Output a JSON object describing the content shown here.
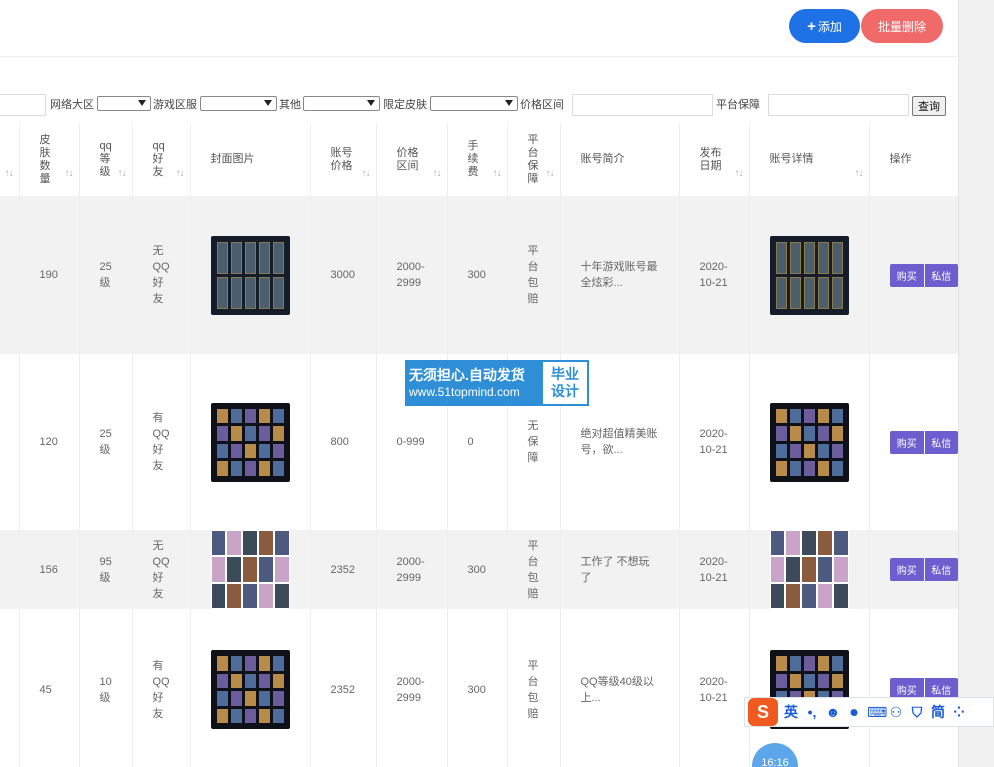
{
  "toolbar": {
    "add_label": "添加",
    "batch_delete_label": "批量删除"
  },
  "filters": {
    "network_label": "网络大区",
    "zone_label": "游戏区服",
    "other_label": "其他",
    "skin_label": "限定皮肤",
    "price_label": "价格区间",
    "guarantee_label": "平台保障",
    "query_label": "查询"
  },
  "table": {
    "headers": {
      "skin_count": "皮肤数量",
      "qq_level": "qq等级",
      "qq_friend": "qq好友",
      "cover": "封面图片",
      "price": "账号价格",
      "price_range": "价格区间",
      "fee": "手续费",
      "guarantee": "平台保障",
      "intro": "账号简介",
      "date": "发布日期",
      "detail": "账号详情",
      "ops": "操作"
    },
    "sort_icon": "↑↓",
    "rows": [
      {
        "skins": "190",
        "level": "25级",
        "friend": "无QQ好友",
        "price": "3000",
        "range": "2000-2999",
        "fee": "300",
        "guarantee": "平台包赔",
        "intro": "十年游戏账号最全炫彩...",
        "date": "2020-10-21"
      },
      {
        "skins": "120",
        "level": "25级",
        "friend": "有QQ好友",
        "price": "800",
        "range": "0-999",
        "fee": "0",
        "guarantee": "无保障",
        "intro": "绝对超值精美账号，欲...",
        "date": "2020-10-21"
      },
      {
        "skins": "156",
        "level": "95级",
        "friend": "无QQ好友",
        "price": "2352",
        "range": "2000-2999",
        "fee": "300",
        "guarantee": "平台包赔",
        "intro": "工作了 不想玩了",
        "date": "2020-10-21"
      },
      {
        "skins": "45",
        "level": "10级",
        "friend": "有QQ好友",
        "price": "2352",
        "range": "2000-2999",
        "fee": "300",
        "guarantee": "平台包赔",
        "intro": "QQ等级40级以上...",
        "date": "2020-10-21"
      }
    ],
    "buy_label": "购买",
    "msg_label": "私信"
  },
  "watermark": {
    "line1": "无须担心.自动发货",
    "line2": "www.51topmind.com",
    "badge1": "毕业",
    "badge2": "设计"
  },
  "ime": {
    "logo": "S",
    "lang": "英",
    "punct": "•,",
    "emoji": "☻",
    "mic": "⏺",
    "keyboard": "⌨",
    "user": "⚇",
    "shirt": "⛉",
    "mode": "简",
    "grid": "⁘"
  },
  "clock": {
    "time": "16:16"
  }
}
